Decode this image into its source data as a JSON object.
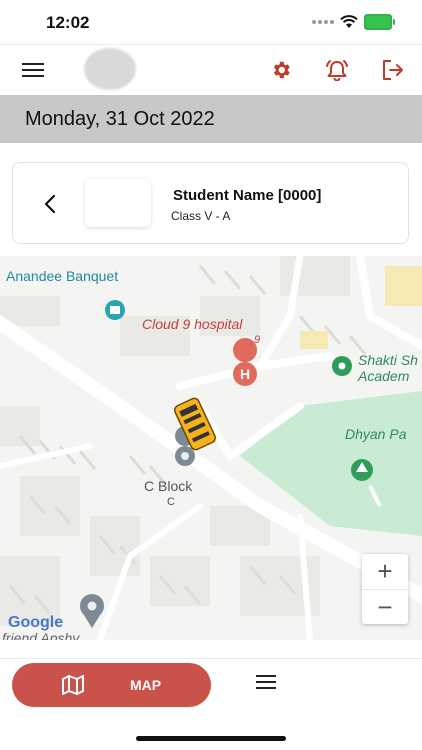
{
  "status_bar": {
    "time": "12:02"
  },
  "header": {
    "menu_icon": "hamburger-icon",
    "settings_icon": "gear-icon",
    "alarm_icon": "alarm-bell-icon",
    "logout_icon": "logout-icon",
    "accent_color": "#c0392b"
  },
  "date": "Monday, 31 Oct 2022",
  "student": {
    "name": "Student Name [0000]",
    "class": "Class V - A"
  },
  "map": {
    "labels": {
      "banquet": "Anandee Banquet",
      "hospital": "Cloud 9 hospital",
      "hospital_sub": "9",
      "academy_line1": "Shakti Sh",
      "academy_line2": "Academ",
      "park": "Dhyan Pa",
      "block": "C Block",
      "block_sub": "C",
      "street": "friend Apshy",
      "google": "Google"
    },
    "zoom_in": "+",
    "zoom_out": "−"
  },
  "bottom_nav": {
    "map_label": "MAP",
    "map_icon": "map-icon",
    "list_icon": "list-icon",
    "active_color": "#c9524a"
  }
}
